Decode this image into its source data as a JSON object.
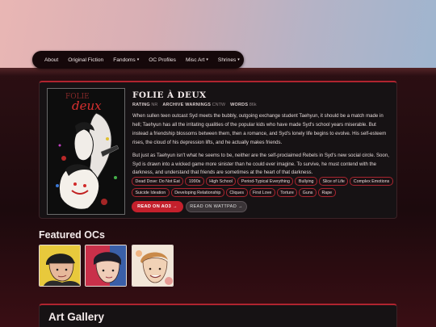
{
  "nav": {
    "items": [
      {
        "label": "About"
      },
      {
        "label": "Original Fiction"
      },
      {
        "label": "Fandoms",
        "caret": "▾"
      },
      {
        "label": "OC Profiles"
      },
      {
        "label": "Misc Art",
        "caret": "▾"
      },
      {
        "label": "Shrines",
        "caret": "▾"
      }
    ]
  },
  "book": {
    "cover_text": "deux",
    "title": "FOLIE À DEUX",
    "meta": [
      {
        "key": "RATING",
        "value": "NR"
      },
      {
        "key": "ARCHIVE WARNINGS",
        "value": "CNTW"
      },
      {
        "key": "WORDS",
        "value": "86k"
      }
    ],
    "description": [
      "When sullen teen outcast Syd meets the bubbly, outgoing exchange student Taehyun, it should be a match made in hell; Taehyun has all the irritating qualities of the popular kids who have made Syd's school years miserable. But instead a friendship blossoms between them, then a romance, and Syd's lonely life begins to evolve. His self-esteem rises, the cloud of his depression lifts, and he actually makes friends.",
      "But just as Taehyun isn't what he seems to be, neither are the self-proclaimed Rebels in Syd's new social circle. Soon, Syd is drawn into a wicked game more sinister than he could ever imagine. To survive, he must contend with the darkness, and understand that friends are sometimes at the heart of that darkness."
    ],
    "tags": [
      "Dead Dove: Do Not Eat",
      "1990s",
      "High School",
      "Period-Typical Everything",
      "Bullying",
      "Slice of Life",
      "Complex Emotions",
      "Suicide Ideation",
      "Developing Relationship",
      "Cliques",
      "First Love",
      "Torture",
      "Guns",
      "Rape"
    ],
    "ao3_button": "READ ON AO3 →",
    "wattpad_button": "READ ON WATTPAD →"
  },
  "featured": {
    "title": "Featured OCs"
  },
  "gallery": {
    "title": "Art Gallery"
  },
  "colors": {
    "accent": "#c4202c",
    "card_bg": "#161214",
    "nav_bg": "#15080a"
  }
}
